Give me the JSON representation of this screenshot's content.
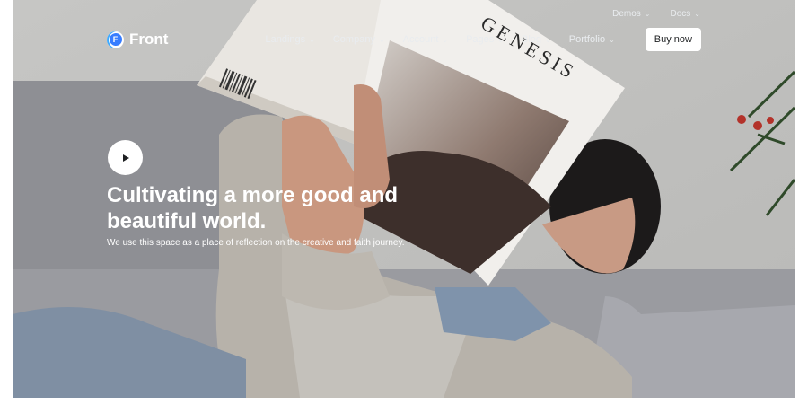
{
  "topbar": {
    "demos": "Demos",
    "docs": "Docs"
  },
  "brand": {
    "name": "Front",
    "mark": "F"
  },
  "nav": {
    "items": [
      {
        "label": "Landings"
      },
      {
        "label": "Company"
      },
      {
        "label": "Account"
      },
      {
        "label": "Pages"
      },
      {
        "label": "Blog"
      },
      {
        "label": "Portfolio"
      }
    ],
    "cta": "Buy now"
  },
  "hero": {
    "headline": "Cultivating a more good and beautiful world.",
    "subtext": "We use this space as a place of reflection on the creative and faith journey.",
    "magazine_title": "GENESIS"
  },
  "icons": {
    "play": "play-icon",
    "chevron": "chevron-down-icon"
  },
  "colors": {
    "nav_text": "#e9ecef",
    "cta_bg": "#ffffff",
    "brand_blue": "#377dff",
    "hero_text": "#ffffff"
  }
}
